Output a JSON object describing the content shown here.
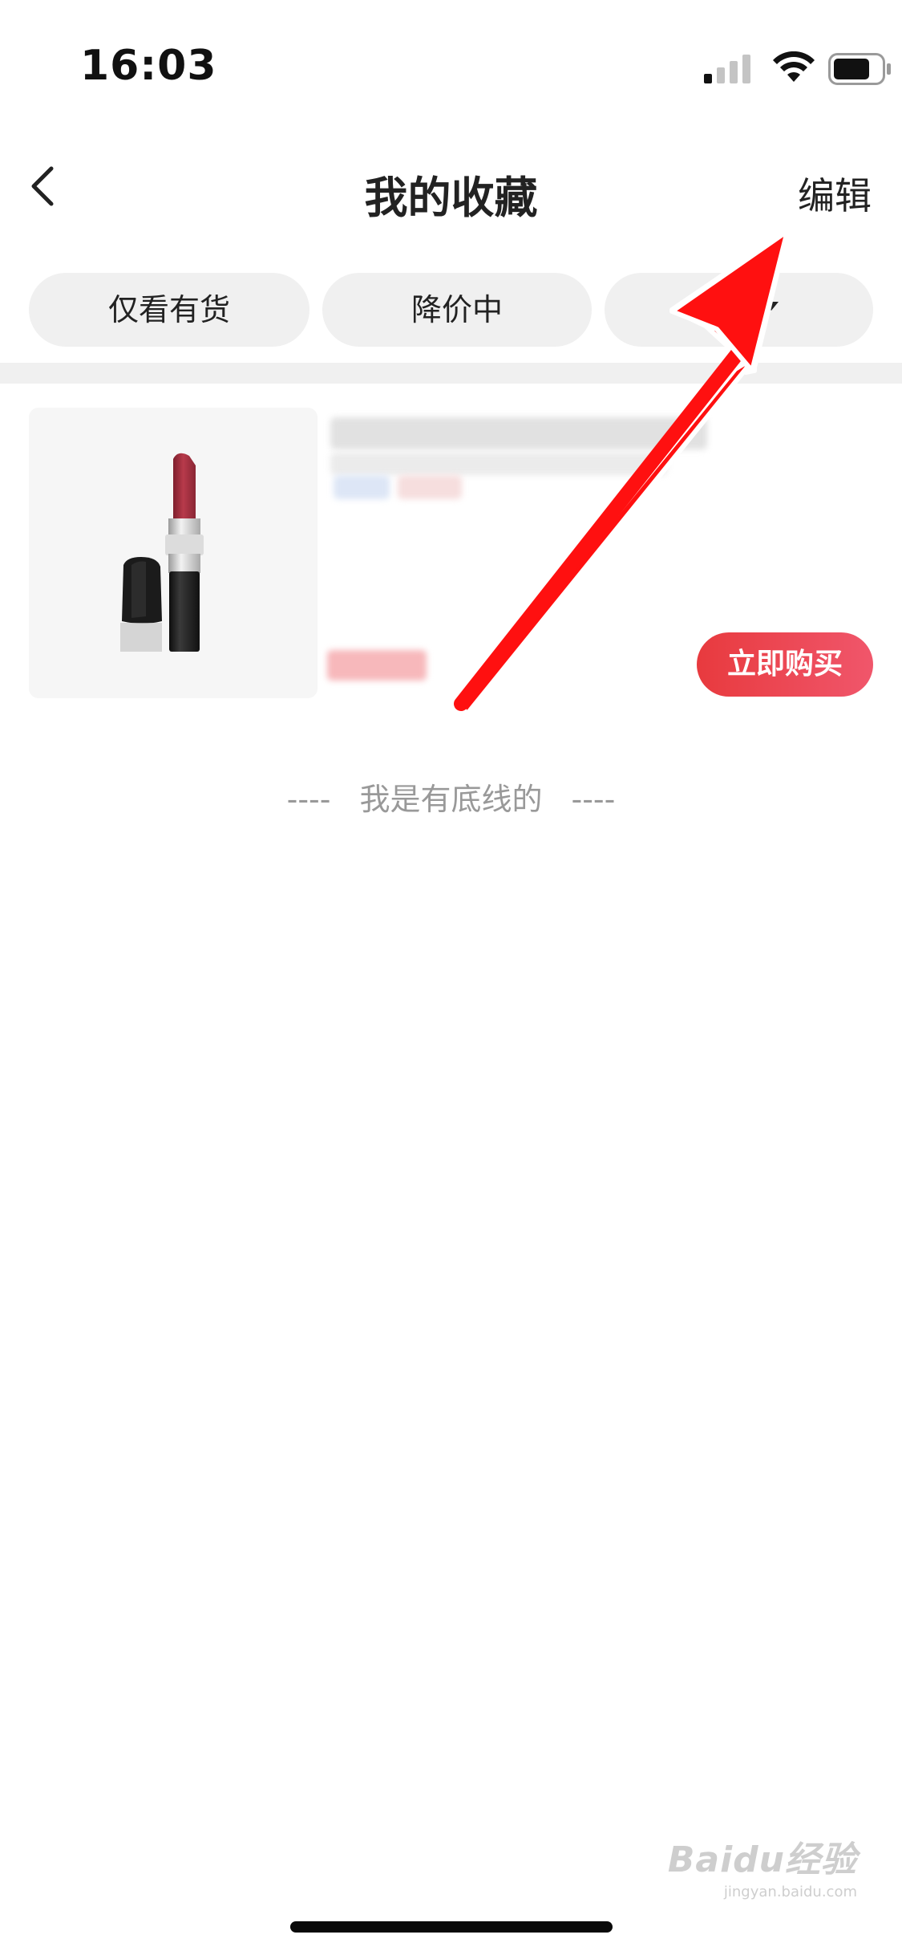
{
  "status_bar": {
    "time": "16:03",
    "icons": [
      "cellular-signal-icon",
      "wifi-icon",
      "battery-icon"
    ]
  },
  "nav": {
    "back_icon": "chevron-left-icon",
    "title": "我的收藏",
    "edit_label": "编辑"
  },
  "filters": {
    "chips": [
      {
        "label": "仅看有货"
      },
      {
        "label": "降价中"
      },
      {
        "label": ""
      }
    ]
  },
  "product": {
    "buy_label": "立即购买"
  },
  "footer": {
    "dashes_left": "----",
    "end_text": "我是有底线的",
    "dashes_right": "----"
  },
  "watermark": {
    "logo": "Baidu经验",
    "url": "jingyan.baidu.com"
  },
  "colors": {
    "accent": "#e83a3e",
    "chip_bg": "#f0f0f0",
    "arrow": "#ff1010"
  }
}
